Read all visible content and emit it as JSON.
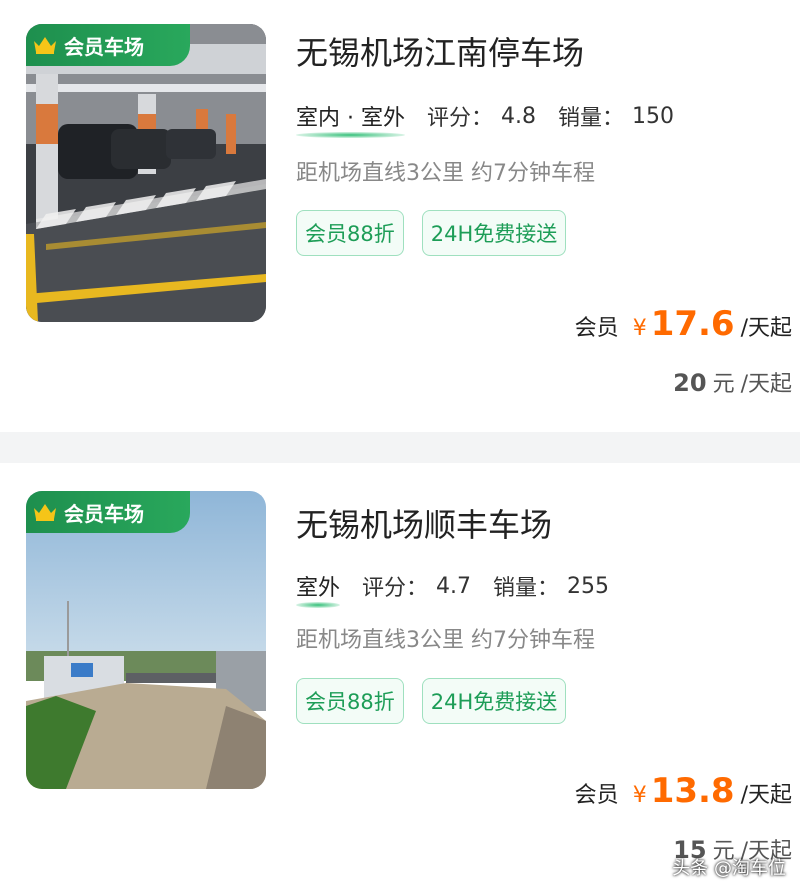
{
  "lots": [
    {
      "badge": "会员车场",
      "title": "无锡机场江南停车场",
      "type": "室内 · 室外",
      "rating_label": "评分：",
      "rating": "4.8",
      "sales_label": "销量：",
      "sales": "150",
      "distance": "距机场直线3公里 约7分钟车程",
      "tags": [
        "会员88折",
        "24H免费接送"
      ],
      "member_label": "会员",
      "currency": "¥",
      "member_price": "17.6",
      "price_unit": "/天起",
      "original_price": "20",
      "original_currency": "元",
      "original_unit": "/天起"
    },
    {
      "badge": "会员车场",
      "title": "无锡机场顺丰车场",
      "type": "室外",
      "rating_label": "评分：",
      "rating": "4.7",
      "sales_label": "销量：",
      "sales": "255",
      "distance": "距机场直线3公里 约7分钟车程",
      "tags": [
        "会员88折",
        "24H免费接送"
      ],
      "member_label": "会员",
      "currency": "¥",
      "member_price": "13.8",
      "price_unit": "/天起",
      "original_price": "15",
      "original_currency": "元",
      "original_unit": "/天起"
    }
  ],
  "watermark": "头条 @淘车位",
  "colors": {
    "accent_green": "#1d9d57",
    "badge_green": "#29a85c",
    "price_orange": "#ff6a00"
  },
  "icons": {
    "badge_icon": "crown-icon"
  }
}
